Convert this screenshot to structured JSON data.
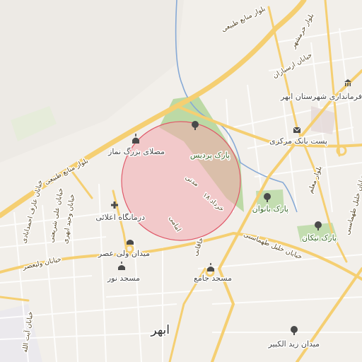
{
  "map": {
    "city_label": "ابهر",
    "places": {
      "pardis_park": "پارک پردیس",
      "mosalla": "مصلای بزرگ نماز",
      "dermangah": "درمانگاه اعلائی",
      "vali_asr_square": "میدان ولی عصر",
      "noor_mosque": "مسجد نور",
      "jame_mosque": "مسجد جامع",
      "zeyd_square": "میدان زید الکبیر",
      "banovan_park": "پارک بانوان",
      "nikan_park": "پارک نیکان",
      "post_bank": "پست بانک مرکزی",
      "governorate": "فرمانداری شهرستان ابهر"
    },
    "roads": {
      "tabiei_n": "بلوار منابع طبیعی",
      "tabiei_w": "بلوار منابع طبیعی",
      "khorramshahr": "بلوار خرمشهر",
      "arasbaran": "خیابان ارسباران",
      "moalem": "بلوار معلم",
      "khalil_tahmasebi": "خیابان خلیل طهماسبی",
      "khalil_short": "خیابان خلیل طهماسبی",
      "madani": "مدنی",
      "khordad": "۱۸ خرداد",
      "emami": "امامی",
      "khaghani": "خاقانی",
      "vali_asr_st": "خیابان ولیعصر",
      "ali_shariati": "خیابان علی شریعتی",
      "ahmadabadi": "خیابان عارف احمدابادی",
      "vahid_abhari": "خیابان وحید ابهری",
      "ayatollah": "خیابان آیت الله"
    },
    "icons": {
      "park": "tree-icon",
      "mosque": "mosque-icon",
      "clinic": "cross-icon",
      "post": "envelope-icon",
      "gov": "government-icon"
    },
    "colors": {
      "highlight_fill": "#f3a9ae",
      "highlight_stroke": "#e05a6a",
      "major_road": "#f5cf72",
      "river": "#86a9d6",
      "park": "#b8d6a0"
    }
  }
}
